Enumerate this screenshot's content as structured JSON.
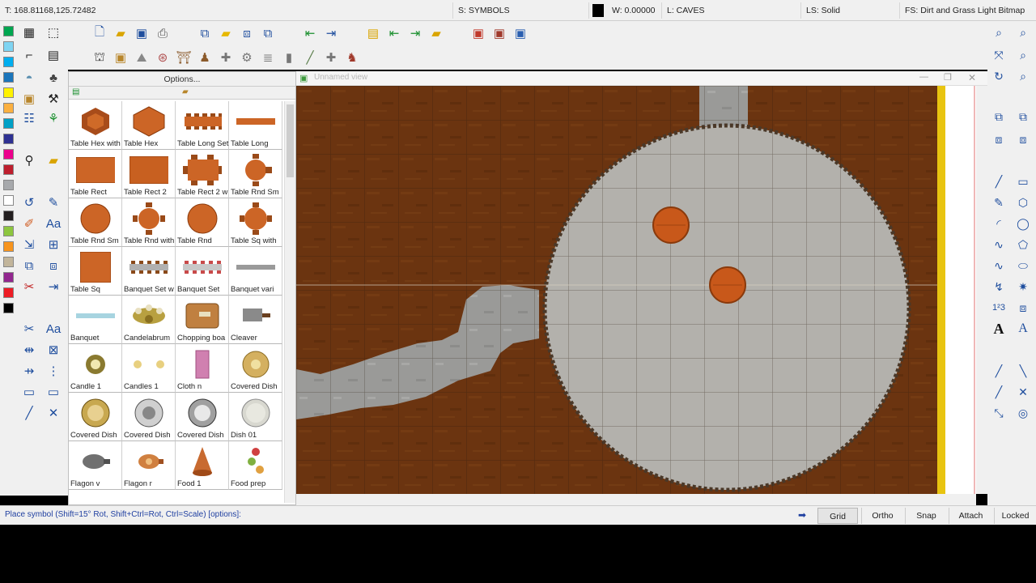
{
  "status_top": {
    "coords": "T: 168.81168,125.72482",
    "symbols": "S: SYMBOLS",
    "width": "W: 0.00000",
    "layer": "L: CAVES",
    "line_style": "LS: Solid",
    "fill_style": "FS: Dirt and Grass Light Bitmap"
  },
  "colors": {
    "current": "#000000",
    "palette": [
      "#00a650",
      "#7fd4f2",
      "#00aeef",
      "#1b75bb",
      "#fff200",
      "#fbb040",
      "#00a0c6",
      "#2e3192",
      "#ec008c",
      "#be1e2d",
      "#a7a9ac",
      "#ffffff",
      "#231f20",
      "#8dc63f",
      "#f7941d",
      "#c2b59b",
      "#92278f",
      "#ed1c24",
      "#000000"
    ]
  },
  "catalog": {
    "options_label": "Options...",
    "items": [
      {
        "label": "Table Hex with",
        "icon": "table-hex-chairs"
      },
      {
        "label": "Table Hex",
        "icon": "table-hex"
      },
      {
        "label": "Table Long Set",
        "icon": "table-long-set"
      },
      {
        "label": "Table Long",
        "icon": "table-long"
      },
      {
        "label": "Table Rect",
        "icon": "table-rect"
      },
      {
        "label": "Table Rect 2",
        "icon": "table-rect-2"
      },
      {
        "label": "Table Rect 2 w",
        "icon": "table-rect-chairs"
      },
      {
        "label": "Table Rnd Sm",
        "icon": "table-round-small-chairs"
      },
      {
        "label": "Table Rnd Sm",
        "icon": "table-round-small"
      },
      {
        "label": "Table Rnd with",
        "icon": "table-round-chairs"
      },
      {
        "label": "Table Rnd",
        "icon": "table-round"
      },
      {
        "label": "Table Sq with",
        "icon": "table-square-chairs"
      },
      {
        "label": "Table Sq",
        "icon": "table-square"
      },
      {
        "label": "Banquet Set w",
        "icon": "banquet-set"
      },
      {
        "label": "Banquet Set",
        "icon": "banquet-set-2"
      },
      {
        "label": "Banquet vari",
        "icon": "banquet-variant"
      },
      {
        "label": "Banquet",
        "icon": "banquet"
      },
      {
        "label": "Candelabrum",
        "icon": "candelabrum"
      },
      {
        "label": "Chopping boa",
        "icon": "chopping-board"
      },
      {
        "label": "Cleaver",
        "icon": "cleaver"
      },
      {
        "label": "Candle 1",
        "icon": "candle"
      },
      {
        "label": "Candles 1",
        "icon": "candles"
      },
      {
        "label": "Cloth n",
        "icon": "cloth"
      },
      {
        "label": "Covered Dish",
        "icon": "covered-dish"
      },
      {
        "label": "Covered Dish",
        "icon": "covered-dish-gold"
      },
      {
        "label": "Covered Dish",
        "icon": "covered-dish-silver"
      },
      {
        "label": "Covered Dish",
        "icon": "covered-dish-dark"
      },
      {
        "label": "Dish 01",
        "icon": "dish"
      },
      {
        "label": "Flagon v",
        "icon": "flagon-v"
      },
      {
        "label": "Flagon r",
        "icon": "flagon-r"
      },
      {
        "label": "Food 1",
        "icon": "food"
      },
      {
        "label": "Food prep",
        "icon": "food-prep"
      }
    ]
  },
  "view": {
    "title": "Unnamed view"
  },
  "status_bottom": {
    "prompt": "Place symbol (Shift=15° Rot, Shift+Ctrl=Rot, Ctrl=Scale) [options]:",
    "buttons": [
      "Grid",
      "Ortho",
      "Snap",
      "Attach",
      "Locked"
    ]
  }
}
